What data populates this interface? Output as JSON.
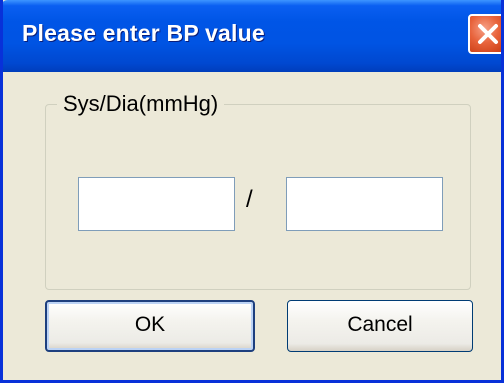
{
  "window": {
    "title": "Please enter BP value"
  },
  "titlebar_buttons": {
    "close_icon": "close-icon"
  },
  "group": {
    "label": "Sys/Dia(mmHg)",
    "separator": "/",
    "systolic_value": "",
    "diastolic_value": ""
  },
  "buttons": {
    "ok_label": "OK",
    "cancel_label": "Cancel"
  },
  "colors": {
    "titlebar": "#0054e3",
    "window_bg": "#ece9d8",
    "close_button": "#e8633b"
  }
}
